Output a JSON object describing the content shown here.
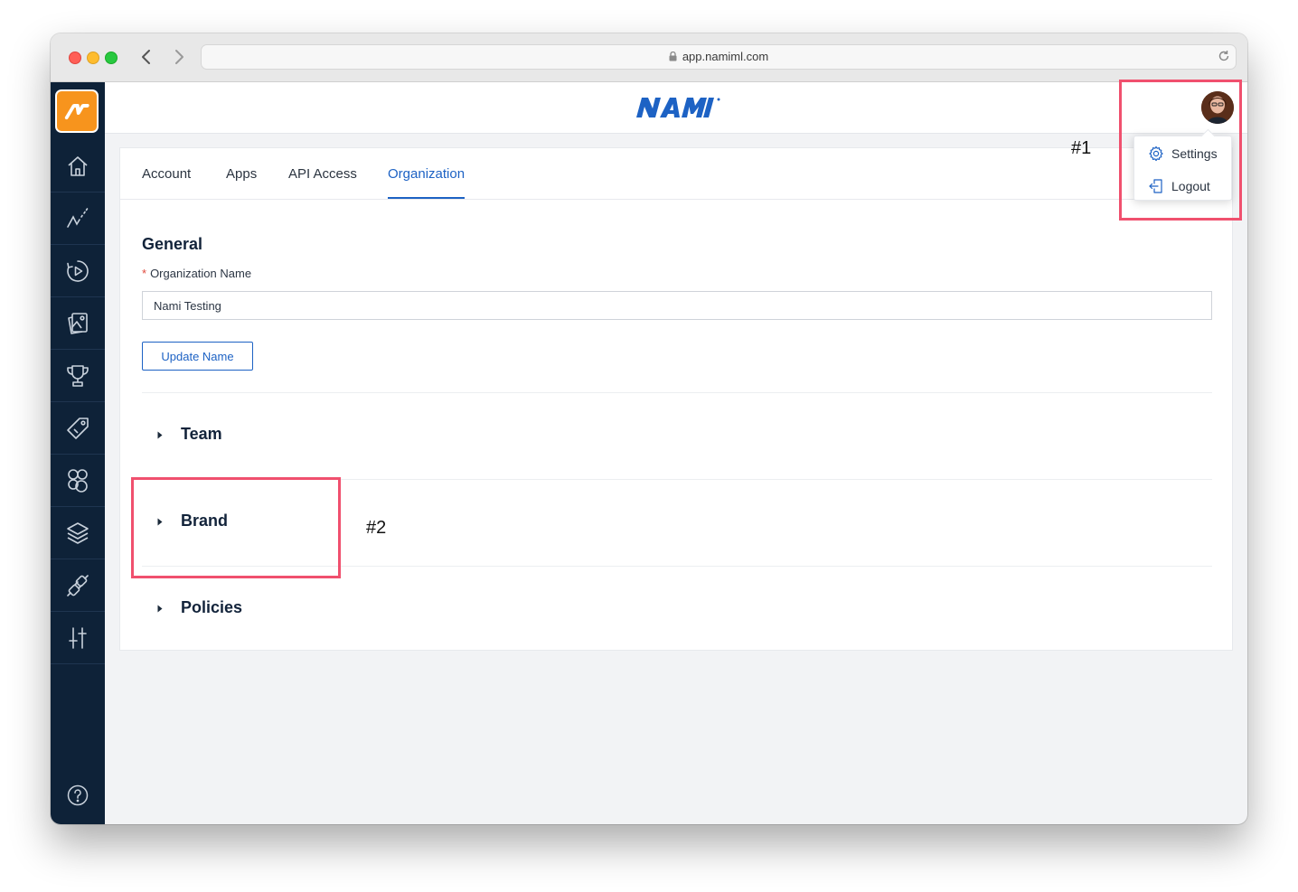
{
  "browser": {
    "url": "app.namiml.com"
  },
  "header": {
    "logo_text": "NAMI"
  },
  "user_menu": {
    "items": [
      {
        "label": "Settings",
        "icon": "gear-icon"
      },
      {
        "label": "Logout",
        "icon": "logout-icon"
      }
    ]
  },
  "sidebar": {
    "items": [
      {
        "icon": "home-icon"
      },
      {
        "icon": "analytics-icon"
      },
      {
        "icon": "campaign-play-icon"
      },
      {
        "icon": "paywall-images-icon"
      },
      {
        "icon": "trophy-icon"
      },
      {
        "icon": "tag-icon"
      },
      {
        "icon": "audience-icon"
      },
      {
        "icon": "layers-icon"
      },
      {
        "icon": "integrations-icon"
      },
      {
        "icon": "sliders-icon"
      }
    ],
    "help_icon": "help-icon"
  },
  "tabs": [
    {
      "label": "Account",
      "active": false
    },
    {
      "label": "Apps",
      "active": false
    },
    {
      "label": "API Access",
      "active": false
    },
    {
      "label": "Organization",
      "active": true
    }
  ],
  "general": {
    "title": "General",
    "org_name_label": "Organization Name",
    "required_mark": "*",
    "org_name_value": "Nami Testing",
    "update_button": "Update Name"
  },
  "sections": [
    {
      "label": "Team"
    },
    {
      "label": "Brand"
    },
    {
      "label": "Policies"
    }
  ],
  "annotations": {
    "marker_1": "#1",
    "marker_2": "#2"
  },
  "colors": {
    "sidebar_bg": "#0e2238",
    "brand_orange": "#f7941d",
    "accent_blue": "#1d62c4",
    "annotation": "#f0506e"
  }
}
